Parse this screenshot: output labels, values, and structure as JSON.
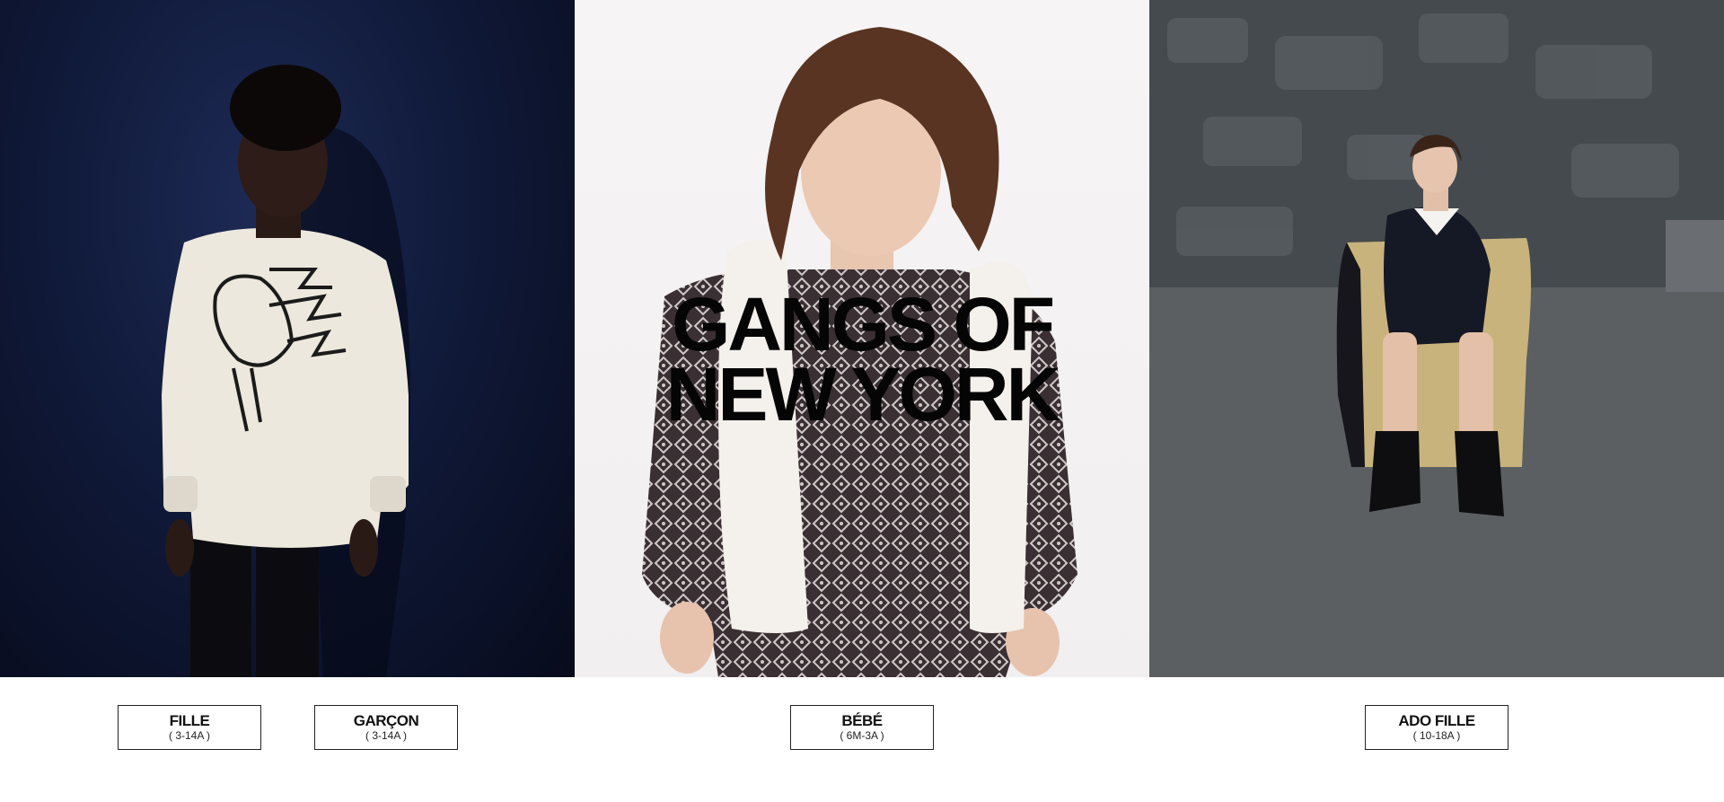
{
  "headline": {
    "line1": "GANGS OF",
    "line2": "NEW YORK"
  },
  "categories": [
    {
      "label": "FILLE",
      "sub": "( 3-14A )"
    },
    {
      "label": "GARÇON",
      "sub": "( 3-14A )"
    },
    {
      "label": "BÉBÉ",
      "sub": "( 6M-3A )"
    },
    {
      "label": "ADO FILLE",
      "sub": "( 10-18A )"
    }
  ]
}
